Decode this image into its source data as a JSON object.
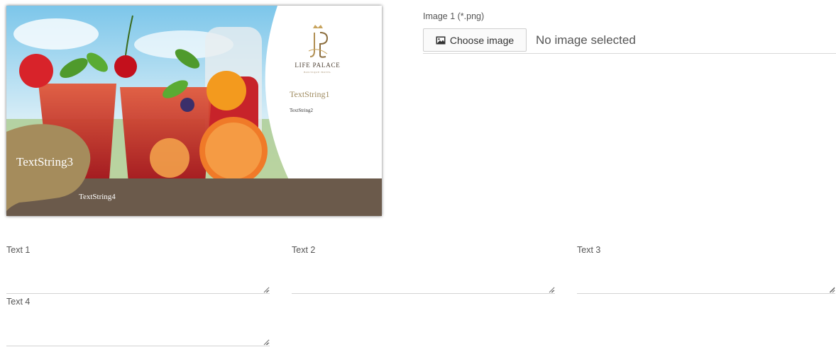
{
  "preview": {
    "logo_name": "LIFE PALACE",
    "logo_subtitle": "BOUTIQUE HOTEL",
    "text_string_1": "TextString1",
    "text_string_2": "TextString2",
    "text_string_3": "TextString3",
    "text_string_4": "TextString4"
  },
  "image_field": {
    "label": "Image 1 (*.png)",
    "button_label": "Choose image",
    "button_icon": "image-icon",
    "status": "No image selected"
  },
  "text_fields": [
    {
      "label": "Text 1",
      "value": ""
    },
    {
      "label": "Text 2",
      "value": ""
    },
    {
      "label": "Text 3",
      "value": ""
    },
    {
      "label": "Text 4",
      "value": ""
    }
  ],
  "colors": {
    "gold_accent": "#a58c5c",
    "bar_brown": "#6b5a4b",
    "label_text": "#555555"
  }
}
